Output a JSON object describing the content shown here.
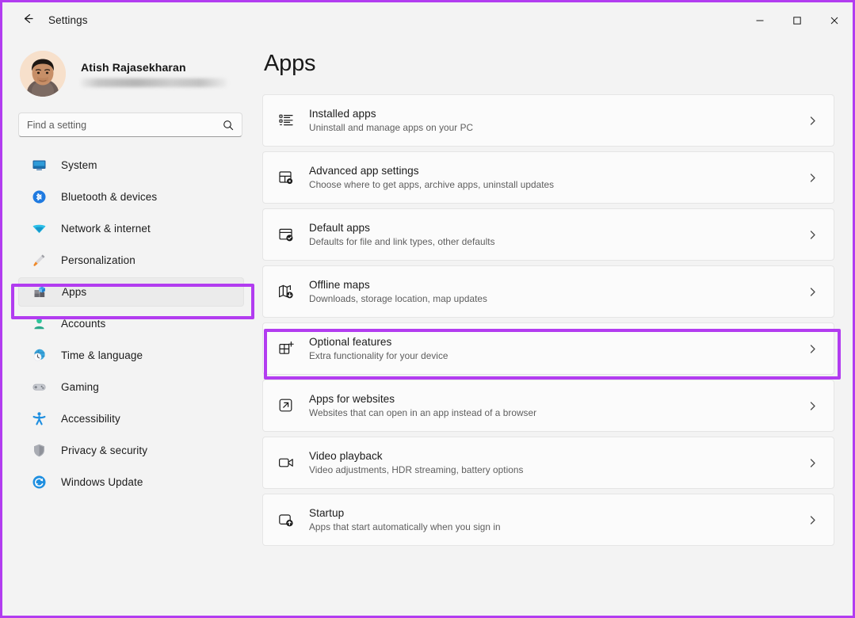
{
  "window": {
    "titlebar_title": "Settings",
    "back_icon": "back-arrow-icon",
    "minimize_label": "−",
    "maximize_label": "□",
    "close_label": "✕"
  },
  "account": {
    "name": "Atish Rajasekharan",
    "email_redacted": ""
  },
  "search": {
    "placeholder": "Find a setting",
    "value": "",
    "icon": "search-icon"
  },
  "sidebar": {
    "items": [
      {
        "label": "System",
        "icon": "monitor-icon",
        "selected": false
      },
      {
        "label": "Bluetooth & devices",
        "icon": "bluetooth-icon",
        "selected": false
      },
      {
        "label": "Network & internet",
        "icon": "wifi-icon",
        "selected": false
      },
      {
        "label": "Personalization",
        "icon": "paintbrush-icon",
        "selected": false
      },
      {
        "label": "Apps",
        "icon": "apps-icon",
        "selected": true
      },
      {
        "label": "Accounts",
        "icon": "person-icon",
        "selected": false
      },
      {
        "label": "Time & language",
        "icon": "clock-globe-icon",
        "selected": false
      },
      {
        "label": "Gaming",
        "icon": "gamepad-icon",
        "selected": false
      },
      {
        "label": "Accessibility",
        "icon": "accessibility-icon",
        "selected": false
      },
      {
        "label": "Privacy & security",
        "icon": "shield-icon",
        "selected": false
      },
      {
        "label": "Windows Update",
        "icon": "update-icon",
        "selected": false
      }
    ]
  },
  "main": {
    "page_title": "Apps",
    "cards": [
      {
        "title": "Installed apps",
        "subtitle": "Uninstall and manage apps on your PC",
        "icon": "list-icon",
        "highlighted": false
      },
      {
        "title": "Advanced app settings",
        "subtitle": "Choose where to get apps, archive apps, uninstall updates",
        "icon": "window-gear-icon",
        "highlighted": false
      },
      {
        "title": "Default apps",
        "subtitle": "Defaults for file and link types, other defaults",
        "icon": "window-check-icon",
        "highlighted": false
      },
      {
        "title": "Offline maps",
        "subtitle": "Downloads, storage location, map updates",
        "icon": "map-download-icon",
        "highlighted": false
      },
      {
        "title": "Optional features",
        "subtitle": "Extra functionality for your device",
        "icon": "grid-plus-icon",
        "highlighted": true
      },
      {
        "title": "Apps for websites",
        "subtitle": "Websites that can open in an app instead of a browser",
        "icon": "external-link-icon",
        "highlighted": false
      },
      {
        "title": "Video playback",
        "subtitle": "Video adjustments, HDR streaming, battery options",
        "icon": "video-camera-icon",
        "highlighted": false
      },
      {
        "title": "Startup",
        "subtitle": "Apps that start automatically when you sign in",
        "icon": "startup-icon",
        "highlighted": false
      }
    ],
    "chevron_icon": "chevron-right-icon"
  },
  "colors": {
    "annotation": "#b23cf0",
    "selection_indicator": "#0067c0",
    "window_background": "#f3f3f3",
    "card_background": "#fbfbfb"
  }
}
